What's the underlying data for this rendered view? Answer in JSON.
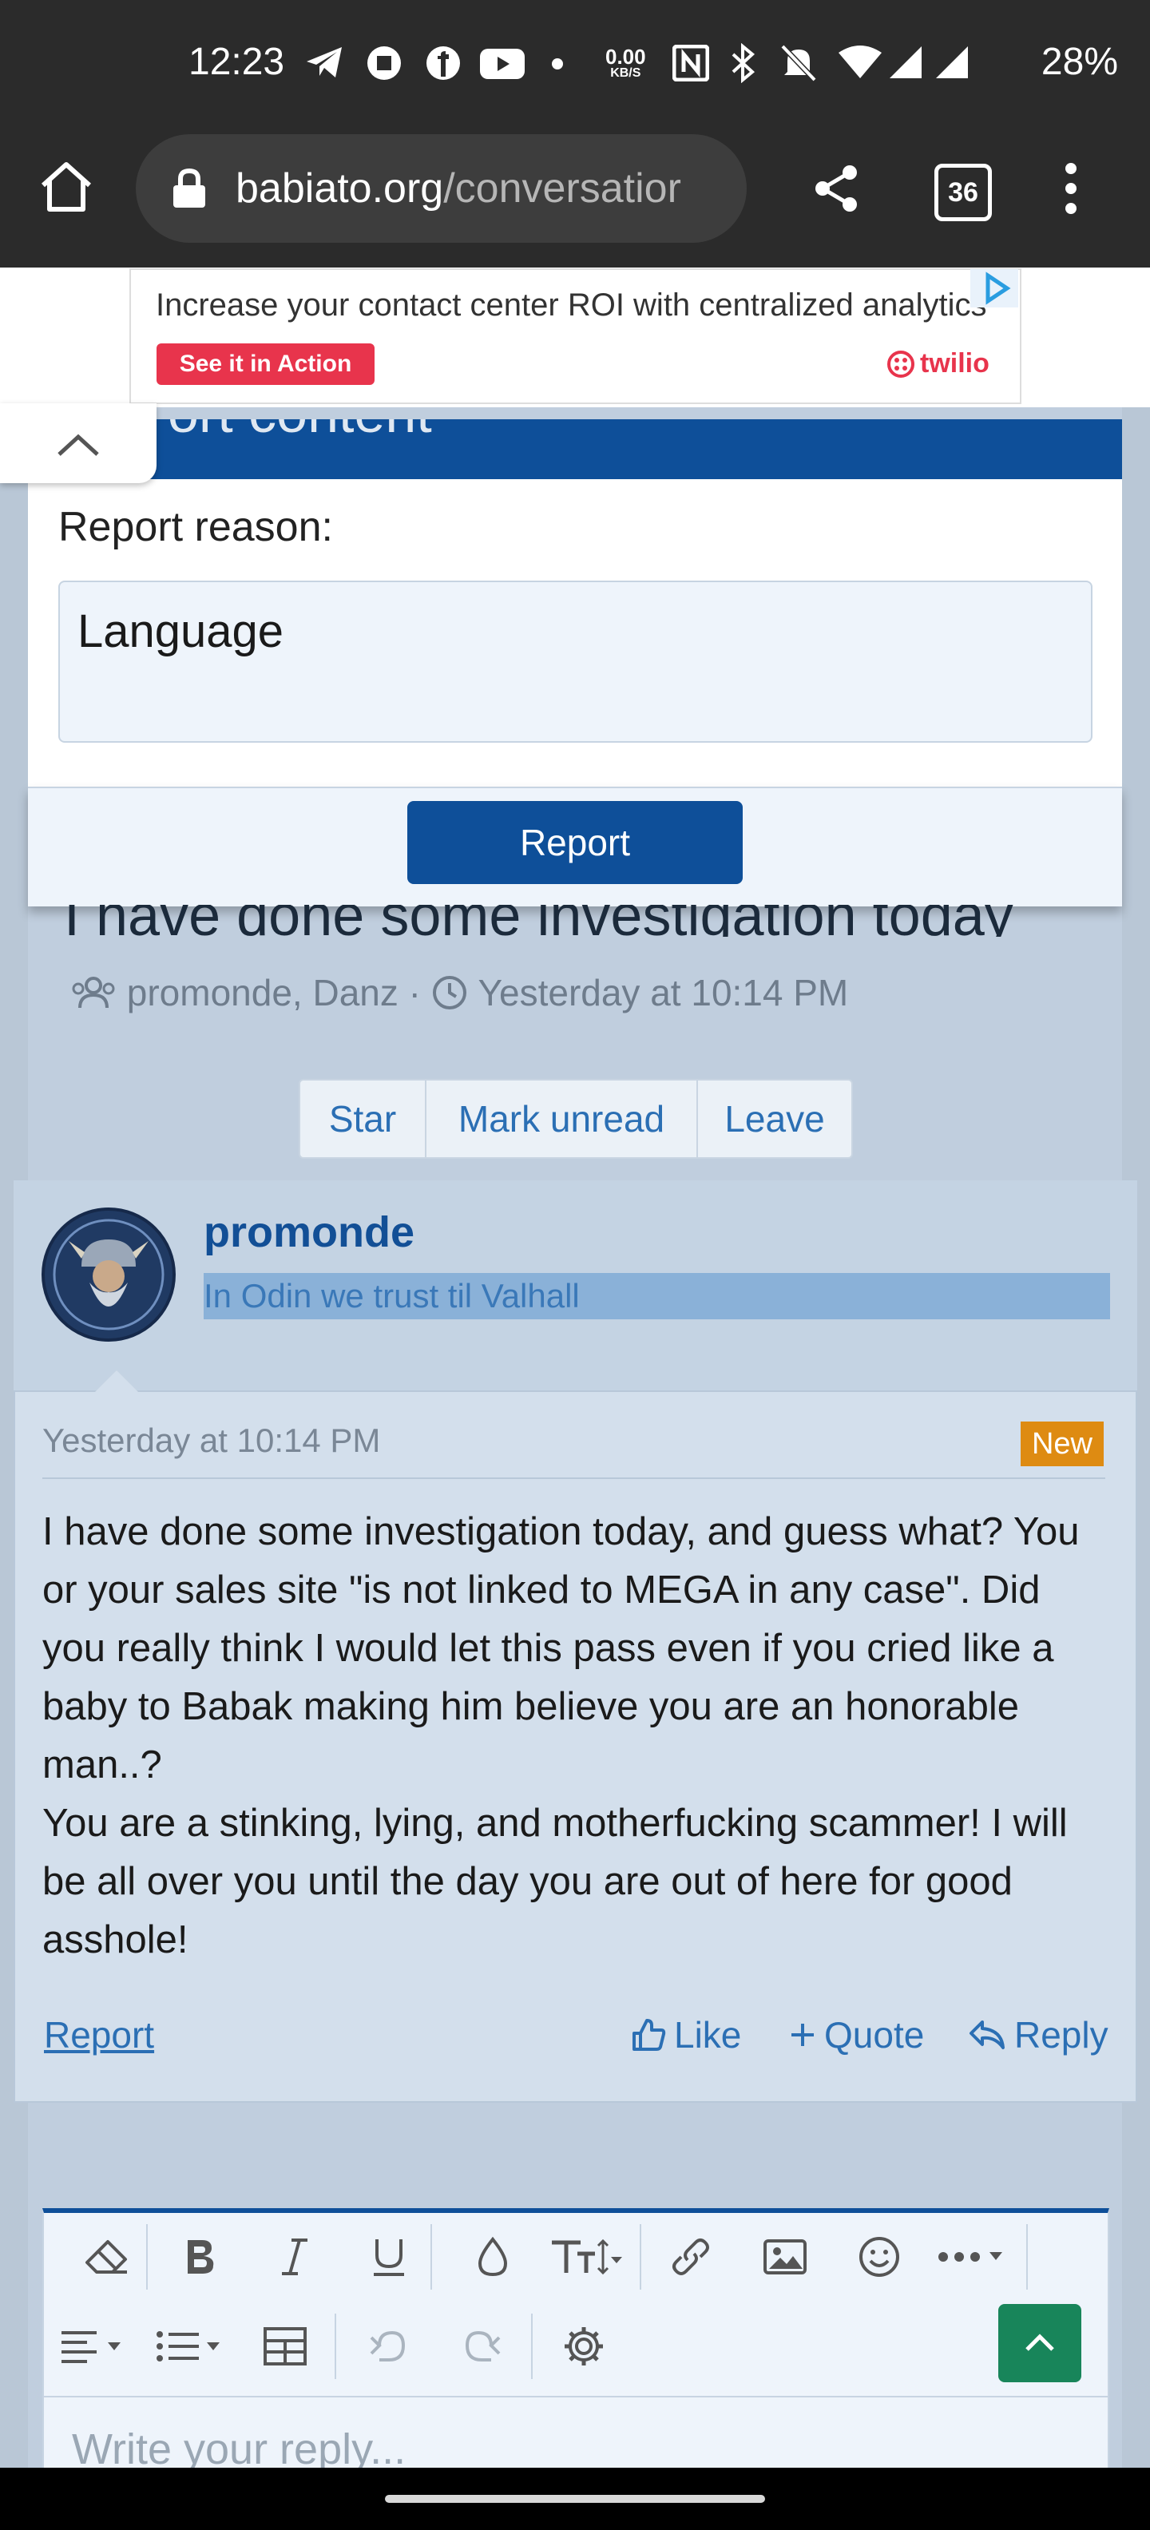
{
  "status_bar": {
    "time": "12:23",
    "net_speed_value": "0.00",
    "net_speed_unit": "KB/S",
    "battery": "28%"
  },
  "browser": {
    "url_host": "babiato.org",
    "url_path": "/conversatior",
    "tab_count": "36"
  },
  "ad": {
    "headline": "Increase your contact center ROI with centralized analytics",
    "cta": "See it in Action",
    "brand": "twilio"
  },
  "report_modal": {
    "title": "ort content",
    "reason_label": "Report reason:",
    "reason_value": "Language",
    "submit_label": "Report"
  },
  "conversation": {
    "title": "I have done some investigation today",
    "participants": "promonde, Danz",
    "separator": "·",
    "started": "Yesterday at 10:14 PM",
    "actions": [
      "Star",
      "Mark unread",
      "Leave"
    ]
  },
  "message": {
    "author": "promonde",
    "user_title": "In Odin we trust til Valhall",
    "date": "Yesterday at 10:14 PM",
    "badge": "New",
    "paragraph_1": "I have done some investigation today, and guess what? You or your sales site \"is not linked to MEGA in any case\". Did you really think I would let this pass even if you cried like a baby to Babak making him believe you are an honorable man..?",
    "paragraph_2": "You are a stinking, lying, and motherfucking scammer! I will be all over you until the day you are out of here for good asshole!",
    "report_label": "Report",
    "like_label": "Like",
    "quote_label": "Quote",
    "reply_label": "Reply"
  },
  "editor": {
    "placeholder": "Write your reply..."
  },
  "colors": {
    "primary": "#0e4f99",
    "link": "#2b6fb4",
    "badge_new": "#de8b12",
    "scroll_top": "#18855a"
  }
}
